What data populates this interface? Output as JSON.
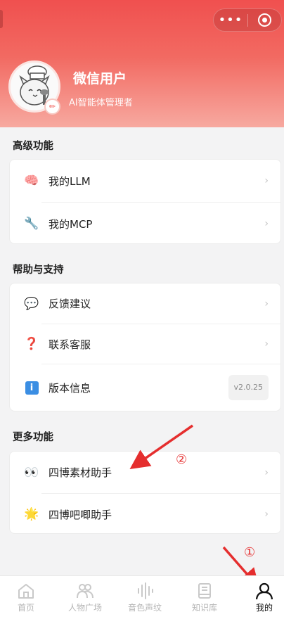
{
  "header": {
    "username": "微信用户",
    "subtitle": "AI智能体管理者",
    "menu_icon": "more-dots-icon",
    "close_icon": "target-circle-icon"
  },
  "sections": [
    {
      "title": "高级功能",
      "items": [
        {
          "icon": "brain-icon",
          "label": "我的LLM"
        },
        {
          "icon": "wrench-icon",
          "label": "我的MCP"
        }
      ]
    },
    {
      "title": "帮助与支持",
      "items": [
        {
          "icon": "speech-bubble-icon",
          "label": "反馈建议"
        },
        {
          "icon": "question-mark-icon",
          "label": "联系客服"
        },
        {
          "icon": "info-icon",
          "label": "版本信息",
          "badge": "v2.0.25"
        }
      ]
    },
    {
      "title": "更多功能",
      "items": [
        {
          "icon": "eyes-icon",
          "label": "四博素材助手"
        },
        {
          "icon": "sparkle-star-icon",
          "label": "四博吧唧助手"
        }
      ]
    }
  ],
  "annotations": {
    "marker1": "①",
    "marker2": "②"
  },
  "tabbar": {
    "tabs": [
      {
        "label": "首页",
        "icon": "home-icon"
      },
      {
        "label": "人物广场",
        "icon": "people-icon"
      },
      {
        "label": "音色声纹",
        "icon": "sound-wave-icon"
      },
      {
        "label": "知识库",
        "icon": "book-icon"
      },
      {
        "label": "我的",
        "icon": "user-icon",
        "active": true
      }
    ]
  },
  "colors": {
    "header_top": "#f0504f",
    "header_bottom": "#f7a9a0",
    "arrow_red": "#e52e2e",
    "tab_inactive": "#b5b5b5",
    "tab_active": "#111111"
  }
}
